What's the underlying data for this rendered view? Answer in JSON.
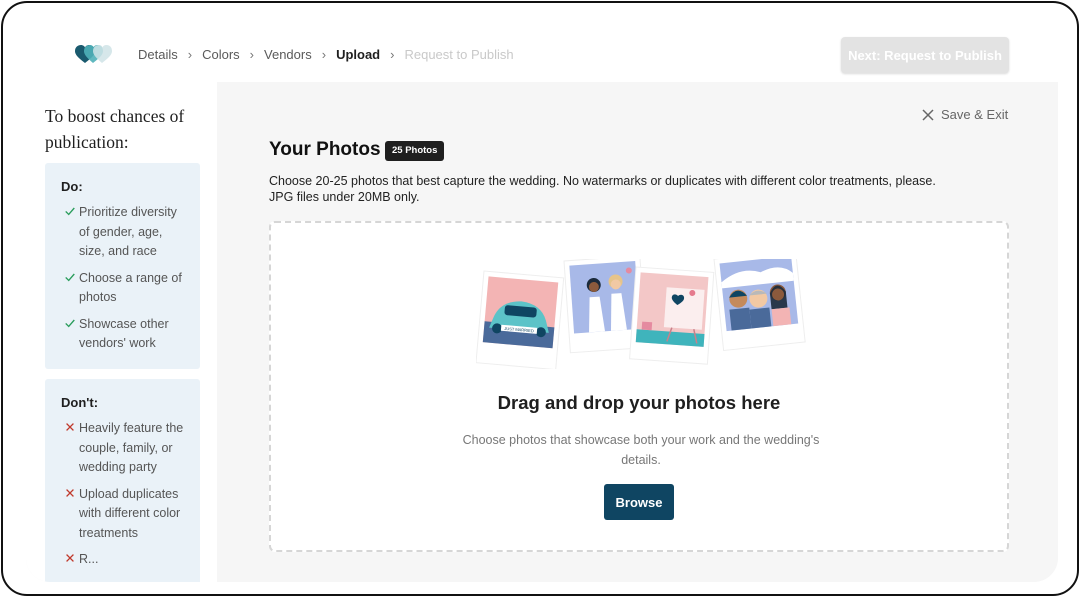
{
  "colors": {
    "accent": "#0f4562",
    "teal": "#2e8b95",
    "check": "#2a9d5c",
    "cross": "#c0392b"
  },
  "breadcrumb": {
    "items": [
      {
        "label": "Details",
        "state": "done"
      },
      {
        "label": "Colors",
        "state": "done"
      },
      {
        "label": "Vendors",
        "state": "done"
      },
      {
        "label": "Upload",
        "state": "active"
      },
      {
        "label": "Request to Publish",
        "state": "disabled"
      }
    ],
    "separator": "›"
  },
  "header": {
    "next_button": "Next: Request to Publish"
  },
  "sidebar": {
    "title": "To boost chances of publication:",
    "do": {
      "heading": "Do:",
      "icon": "check-icon",
      "items": [
        "Prioritize diversity of gender, age, size, and race",
        "Choose a range of photos",
        "Showcase other vendors' work"
      ]
    },
    "dont": {
      "heading": "Don't:",
      "icon": "cross-icon",
      "items": [
        "Heavily feature the couple, family, or wedding party",
        "Upload duplicates with different color treatments",
        "R..."
      ]
    }
  },
  "main": {
    "save_exit": "Save & Exit",
    "title": "Your Photos",
    "count_badge": "25 Photos",
    "description_line1": "Choose 20-25 photos that best capture the wedding. No watermarks or duplicates with different color treatments, please.",
    "description_line2": "JPG files under 20MB only.",
    "dropzone": {
      "title": "Drag and drop your photos here",
      "subtitle": "Choose photos that showcase both your work and the wedding's details.",
      "browse_button": "Browse",
      "car_plate": "JUST MARRIED"
    }
  }
}
